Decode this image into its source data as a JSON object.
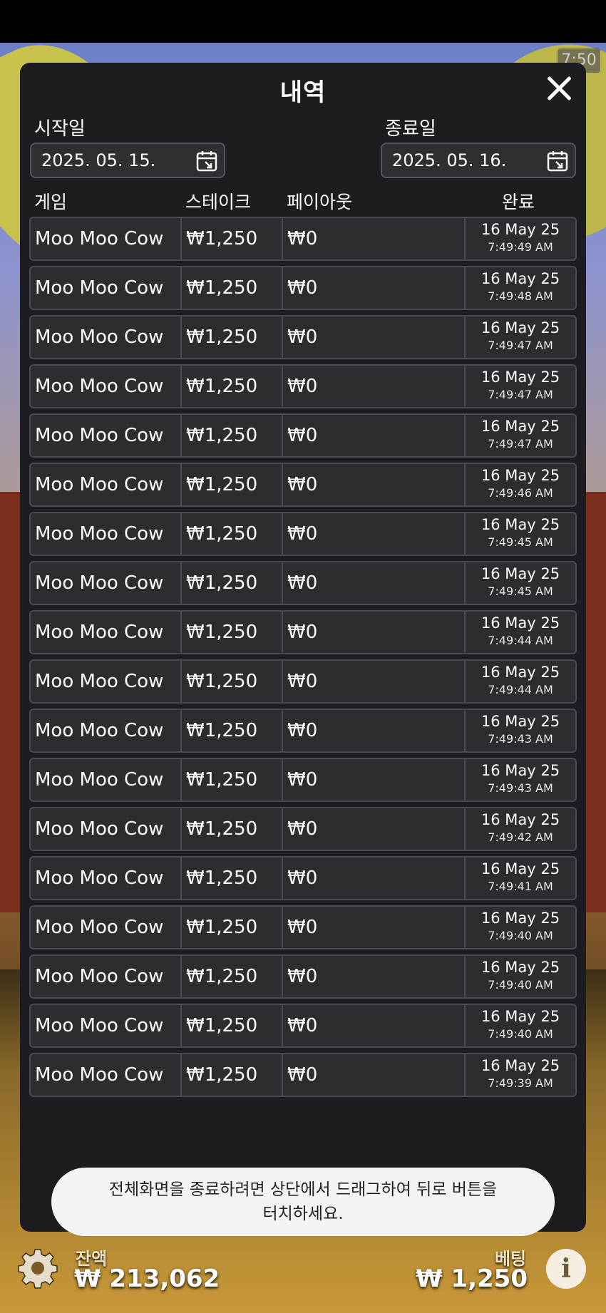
{
  "status": {
    "time": "7:50"
  },
  "panel": {
    "title": "내역",
    "start_label": "시작일",
    "start_value": "2025. 05. 15.",
    "end_label": "종료일",
    "end_value": "2025. 05. 16."
  },
  "headers": {
    "game": "게임",
    "stake": "스테이크",
    "payout": "페이아웃",
    "completed": "완료"
  },
  "rows": [
    {
      "game": "Moo Moo Cow",
      "stake": "₩1,250",
      "payout": "₩0",
      "date": "16 May 25",
      "time": "7:49:49 AM"
    },
    {
      "game": "Moo Moo Cow",
      "stake": "₩1,250",
      "payout": "₩0",
      "date": "16 May 25",
      "time": "7:49:48 AM"
    },
    {
      "game": "Moo Moo Cow",
      "stake": "₩1,250",
      "payout": "₩0",
      "date": "16 May 25",
      "time": "7:49:47 AM"
    },
    {
      "game": "Moo Moo Cow",
      "stake": "₩1,250",
      "payout": "₩0",
      "date": "16 May 25",
      "time": "7:49:47 AM"
    },
    {
      "game": "Moo Moo Cow",
      "stake": "₩1,250",
      "payout": "₩0",
      "date": "16 May 25",
      "time": "7:49:47 AM"
    },
    {
      "game": "Moo Moo Cow",
      "stake": "₩1,250",
      "payout": "₩0",
      "date": "16 May 25",
      "time": "7:49:46 AM"
    },
    {
      "game": "Moo Moo Cow",
      "stake": "₩1,250",
      "payout": "₩0",
      "date": "16 May 25",
      "time": "7:49:45 AM"
    },
    {
      "game": "Moo Moo Cow",
      "stake": "₩1,250",
      "payout": "₩0",
      "date": "16 May 25",
      "time": "7:49:45 AM"
    },
    {
      "game": "Moo Moo Cow",
      "stake": "₩1,250",
      "payout": "₩0",
      "date": "16 May 25",
      "time": "7:49:44 AM"
    },
    {
      "game": "Moo Moo Cow",
      "stake": "₩1,250",
      "payout": "₩0",
      "date": "16 May 25",
      "time": "7:49:44 AM"
    },
    {
      "game": "Moo Moo Cow",
      "stake": "₩1,250",
      "payout": "₩0",
      "date": "16 May 25",
      "time": "7:49:43 AM"
    },
    {
      "game": "Moo Moo Cow",
      "stake": "₩1,250",
      "payout": "₩0",
      "date": "16 May 25",
      "time": "7:49:43 AM"
    },
    {
      "game": "Moo Moo Cow",
      "stake": "₩1,250",
      "payout": "₩0",
      "date": "16 May 25",
      "time": "7:49:42 AM"
    },
    {
      "game": "Moo Moo Cow",
      "stake": "₩1,250",
      "payout": "₩0",
      "date": "16 May 25",
      "time": "7:49:41 AM"
    },
    {
      "game": "Moo Moo Cow",
      "stake": "₩1,250",
      "payout": "₩0",
      "date": "16 May 25",
      "time": "7:49:40 AM"
    },
    {
      "game": "Moo Moo Cow",
      "stake": "₩1,250",
      "payout": "₩0",
      "date": "16 May 25",
      "time": "7:49:40 AM"
    },
    {
      "game": "Moo Moo Cow",
      "stake": "₩1,250",
      "payout": "₩0",
      "date": "16 May 25",
      "time": "7:49:40 AM"
    },
    {
      "game": "Moo Moo Cow",
      "stake": "₩1,250",
      "payout": "₩0",
      "date": "16 May 25",
      "time": "7:49:39 AM"
    }
  ],
  "toast": {
    "line1": "전체화면을 종료하려면 상단에서 드래그하여 뒤로 버튼을",
    "line2": "터치하세요."
  },
  "bottom": {
    "balance_label": "잔액",
    "balance_value": "₩ 213,062",
    "bet_label": "베팅",
    "bet_value": "₩ 1,250"
  },
  "icons": {
    "close": "close-icon",
    "calendar": "calendar-icon",
    "settings": "gear-icon",
    "info": "info-icon"
  },
  "colors": {
    "panel_bg": "#1d1d21",
    "row_bg": "#2c2c31",
    "row_border": "#4a4a50"
  }
}
